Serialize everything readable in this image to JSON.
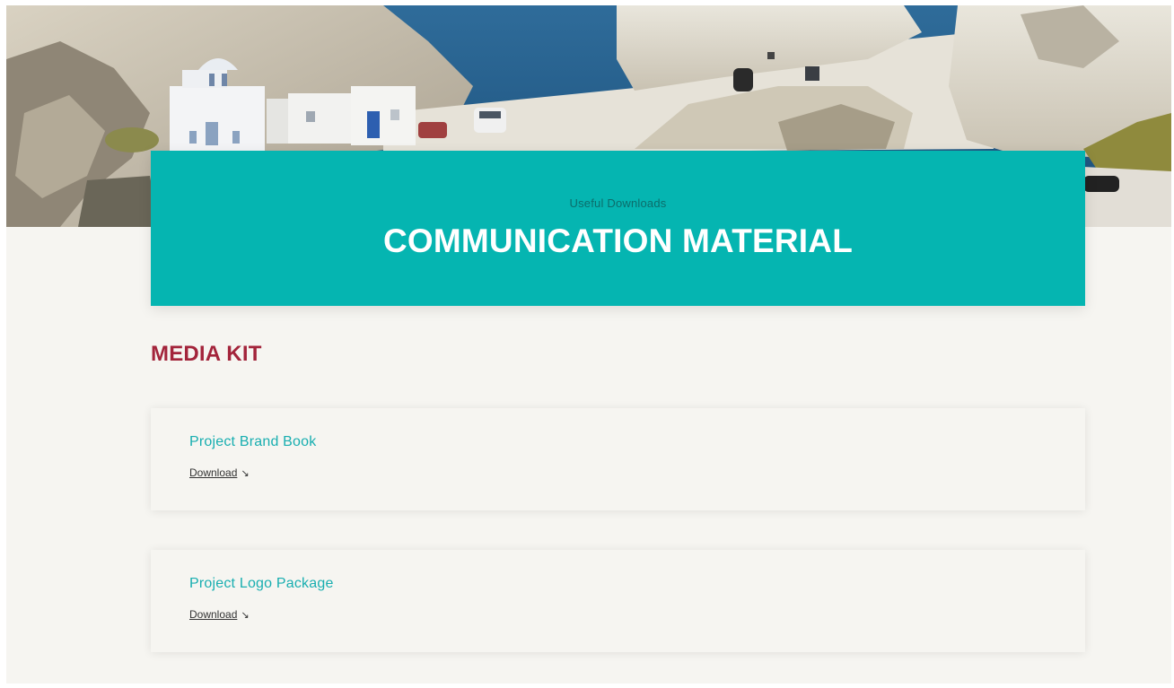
{
  "banner": {
    "eyebrow": "Useful Downloads",
    "title": "COMMUNICATION MATERIAL"
  },
  "section": {
    "title": "MEDIA KIT"
  },
  "items": [
    {
      "title": "Project Brand Book",
      "link_label": "Download",
      "link_icon": "download-arrow-icon"
    },
    {
      "title": "Project Logo Package",
      "link_label": "Download",
      "link_icon": "download-arrow-icon"
    }
  ],
  "colors": {
    "banner_bg": "#05b5b1",
    "section_title": "#a3243b",
    "item_title": "#18aeb0",
    "page_bg": "#f6f5f1"
  }
}
